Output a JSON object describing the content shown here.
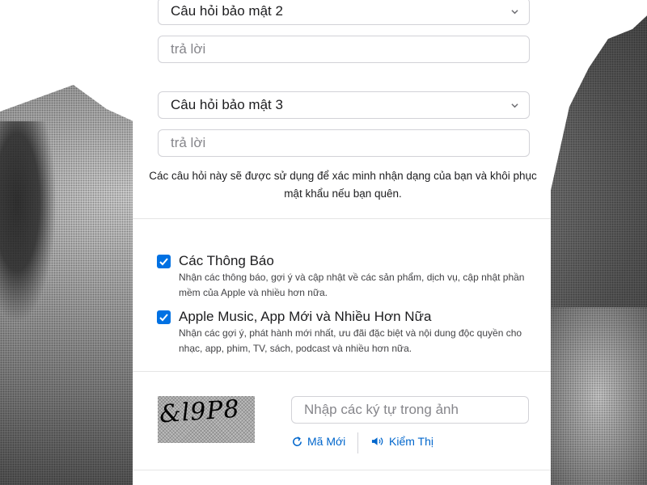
{
  "security": {
    "question2": {
      "label": "Câu hỏi bảo mật 2",
      "answer_placeholder": "trả lời"
    },
    "question3": {
      "label": "Câu hỏi bảo mật 3",
      "answer_placeholder": "trả lời"
    },
    "hint": "Các câu hỏi này sẽ được sử dụng để xác minh nhận dạng của bạn và khôi phục mật khẩu nếu bạn quên."
  },
  "options": [
    {
      "title": "Các Thông Báo",
      "description": "Nhận các thông báo, gợi ý và cập nhật về các sản phẩm, dịch vụ, cập nhật phần mềm của Apple và nhiều hơn nữa.",
      "checked": true
    },
    {
      "title": "Apple Music, App Mới và Nhiều Hơn Nữa",
      "description": "Nhận các gợi ý, phát hành mới nhất, ưu đãi đặc biệt và nội dung độc quyền cho nhạc, app, phim, TV, sách, podcast và nhiều hơn nữa.",
      "checked": true
    }
  ],
  "captcha": {
    "image_text": "&l9P8",
    "input_placeholder": "Nhập các ký tự trong ảnh",
    "new_label": "Mã Mới",
    "audio_label": "Kiểm Thị"
  },
  "colors": {
    "accent": "#0071e3",
    "link": "#0066cc",
    "border": "#d2d2d7"
  },
  "icons": {
    "refresh": "refresh-icon",
    "speaker": "speaker-icon",
    "chevron": "chevron-down-icon",
    "check": "checkmark-icon"
  }
}
